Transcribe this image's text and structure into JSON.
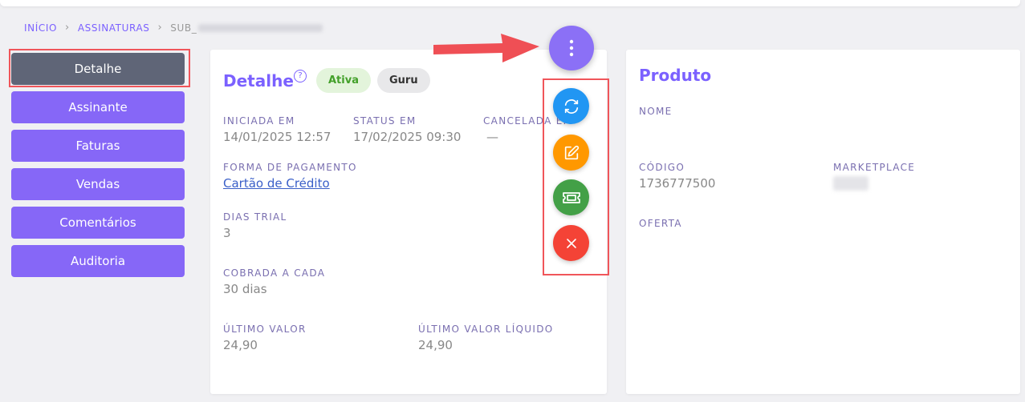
{
  "breadcrumb": {
    "items": [
      "INÍCIO",
      "ASSINATURAS"
    ],
    "current": "SUB_"
  },
  "sidebar": {
    "items": [
      {
        "label": "Detalhe",
        "active": true
      },
      {
        "label": "Assinante"
      },
      {
        "label": "Faturas"
      },
      {
        "label": "Vendas"
      },
      {
        "label": "Comentários"
      },
      {
        "label": "Auditoria"
      }
    ]
  },
  "detail": {
    "title": "Detalhe",
    "help_icon": "question-circle-icon",
    "badges": {
      "status": "Ativa",
      "platform": "Guru"
    },
    "started_label": "INICIADA EM",
    "started_value": "14/01/2025 12:57",
    "status_label": "STATUS EM",
    "status_value": "17/02/2025 09:30",
    "canceled_label": "CANCELADA EM",
    "canceled_value": "—",
    "payment_label": "FORMA DE PAGAMENTO",
    "payment_value": "Cartão de Crédito",
    "trial_label": "DIAS TRIAL",
    "trial_value": "3",
    "charged_label": "COBRADA A CADA",
    "charged_value": "30 dias",
    "last_value_label": "ÚLTIMO VALOR",
    "last_value": "24,90",
    "last_net_label": "ÚLTIMO VALOR LÍQUIDO",
    "last_net_value": "24,90"
  },
  "product": {
    "title": "Produto",
    "name_label": "NOME",
    "code_label": "CÓDIGO",
    "code_value": "1736777500",
    "marketplace_label": "MARKETPLACE",
    "offer_label": "OFERTA"
  },
  "actions": {
    "menu_icon": "more-vertical-icon",
    "refresh_icon": "refresh-icon",
    "edit_icon": "edit-icon",
    "ticket_icon": "ticket-icon",
    "cancel_icon": "close-icon"
  },
  "colors": {
    "accent": "#7b61ff",
    "nav": "#8667f7",
    "nav_active": "#5f6577",
    "refresh": "#2196f3",
    "edit": "#ff9800",
    "ticket": "#43a047",
    "cancel": "#f44336",
    "highlight": "#f0555a"
  }
}
